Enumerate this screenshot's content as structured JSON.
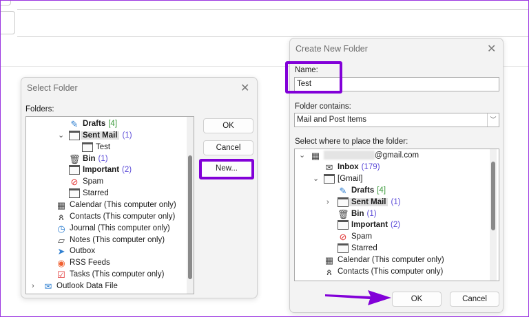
{
  "select_folder": {
    "title": "Select Folder",
    "folders_label": "Folders:",
    "buttons": {
      "ok": "OK",
      "cancel": "Cancel",
      "new": "New..."
    },
    "tree": [
      {
        "label": "Drafts",
        "count": "[4]",
        "count_style": "green",
        "bold": true,
        "icon": "drafts-icon",
        "level": 2
      },
      {
        "label": "Sent Mail",
        "count": "(1)",
        "bold": true,
        "icon": "folder-icon",
        "level": 2,
        "chevron": "expanded",
        "selected": true
      },
      {
        "label": "Test",
        "icon": "folder-icon",
        "level": 3
      },
      {
        "label": "Bin",
        "count": "(1)",
        "bold": true,
        "icon": "trash-icon",
        "level": 2
      },
      {
        "label": "Important",
        "count": "(2)",
        "bold": true,
        "icon": "folder-icon",
        "level": 2
      },
      {
        "label": "Spam",
        "icon": "spam-icon",
        "level": 2
      },
      {
        "label": "Starred",
        "icon": "folder-icon",
        "level": 2
      },
      {
        "label": "Calendar (This computer only)",
        "icon": "calendar-icon",
        "level": 1
      },
      {
        "label": "Contacts (This computer only)",
        "icon": "contacts-icon",
        "level": 1
      },
      {
        "label": "Journal (This computer only)",
        "icon": "journal-icon",
        "level": 1
      },
      {
        "label": "Notes (This computer only)",
        "icon": "notes-icon",
        "level": 1
      },
      {
        "label": "Outbox",
        "icon": "outbox-icon",
        "level": 1
      },
      {
        "label": "RSS Feeds",
        "icon": "rss-icon",
        "level": 1
      },
      {
        "label": "Tasks (This computer only)",
        "icon": "tasks-icon",
        "level": 1
      },
      {
        "label": "Outlook Data File",
        "icon": "data-file-icon",
        "level": 0,
        "chevron": "collapsed"
      }
    ]
  },
  "create_folder": {
    "title": "Create New Folder",
    "name_label": "Name:",
    "name_value": "Test",
    "contains_label": "Folder contains:",
    "contains_value": "Mail and Post Items",
    "place_label": "Select where to place the folder:",
    "buttons": {
      "ok": "OK",
      "cancel": "Cancel"
    },
    "tree": [
      {
        "label": "@gmail.com",
        "icon": "account-icon",
        "level": 0,
        "chevron": "expanded",
        "redacted": true
      },
      {
        "label": "Inbox",
        "count": "(179)",
        "bold": true,
        "icon": "inbox-icon",
        "level": 1
      },
      {
        "label": "[Gmail]",
        "icon": "folder-icon",
        "level": 1,
        "chevron": "expanded"
      },
      {
        "label": "Drafts",
        "count": "[4]",
        "count_style": "green",
        "bold": true,
        "icon": "drafts-icon",
        "level": 2
      },
      {
        "label": "Sent Mail",
        "count": "(1)",
        "bold": true,
        "icon": "folder-icon",
        "level": 2,
        "chevron": "collapsed",
        "selected": true
      },
      {
        "label": "Bin",
        "count": "(1)",
        "bold": true,
        "icon": "trash-icon",
        "level": 2
      },
      {
        "label": "Important",
        "count": "(2)",
        "bold": true,
        "icon": "folder-icon",
        "level": 2
      },
      {
        "label": "Spam",
        "icon": "spam-icon",
        "level": 2
      },
      {
        "label": "Starred",
        "icon": "folder-icon",
        "level": 2
      },
      {
        "label": "Calendar (This computer only)",
        "icon": "calendar-icon",
        "level": 1
      },
      {
        "label": "Contacts (This computer only)",
        "icon": "contacts-icon",
        "level": 1
      },
      {
        "label": "",
        "icon": "journal-icon",
        "level": 1
      }
    ]
  },
  "colors": {
    "highlight": "#8200d8",
    "count": "#5b4bd8",
    "drafts_count": "#3a9a3a"
  }
}
